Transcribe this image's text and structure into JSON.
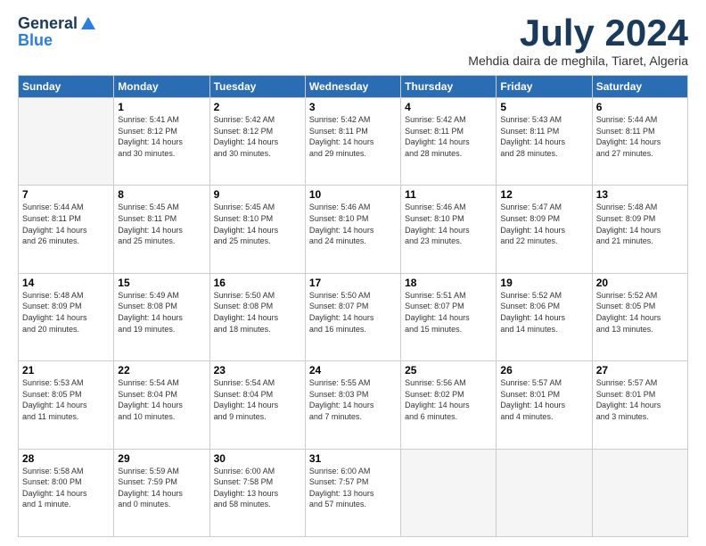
{
  "logo": {
    "general": "General",
    "blue": "Blue"
  },
  "title": "July 2024",
  "location": "Mehdia daira de meghila, Tiaret, Algeria",
  "days_header": [
    "Sunday",
    "Monday",
    "Tuesday",
    "Wednesday",
    "Thursday",
    "Friday",
    "Saturday"
  ],
  "weeks": [
    [
      {
        "day": "",
        "info": ""
      },
      {
        "day": "1",
        "info": "Sunrise: 5:41 AM\nSunset: 8:12 PM\nDaylight: 14 hours\nand 30 minutes."
      },
      {
        "day": "2",
        "info": "Sunrise: 5:42 AM\nSunset: 8:12 PM\nDaylight: 14 hours\nand 30 minutes."
      },
      {
        "day": "3",
        "info": "Sunrise: 5:42 AM\nSunset: 8:11 PM\nDaylight: 14 hours\nand 29 minutes."
      },
      {
        "day": "4",
        "info": "Sunrise: 5:42 AM\nSunset: 8:11 PM\nDaylight: 14 hours\nand 28 minutes."
      },
      {
        "day": "5",
        "info": "Sunrise: 5:43 AM\nSunset: 8:11 PM\nDaylight: 14 hours\nand 28 minutes."
      },
      {
        "day": "6",
        "info": "Sunrise: 5:44 AM\nSunset: 8:11 PM\nDaylight: 14 hours\nand 27 minutes."
      }
    ],
    [
      {
        "day": "7",
        "info": "Sunrise: 5:44 AM\nSunset: 8:11 PM\nDaylight: 14 hours\nand 26 minutes."
      },
      {
        "day": "8",
        "info": "Sunrise: 5:45 AM\nSunset: 8:11 PM\nDaylight: 14 hours\nand 25 minutes."
      },
      {
        "day": "9",
        "info": "Sunrise: 5:45 AM\nSunset: 8:10 PM\nDaylight: 14 hours\nand 25 minutes."
      },
      {
        "day": "10",
        "info": "Sunrise: 5:46 AM\nSunset: 8:10 PM\nDaylight: 14 hours\nand 24 minutes."
      },
      {
        "day": "11",
        "info": "Sunrise: 5:46 AM\nSunset: 8:10 PM\nDaylight: 14 hours\nand 23 minutes."
      },
      {
        "day": "12",
        "info": "Sunrise: 5:47 AM\nSunset: 8:09 PM\nDaylight: 14 hours\nand 22 minutes."
      },
      {
        "day": "13",
        "info": "Sunrise: 5:48 AM\nSunset: 8:09 PM\nDaylight: 14 hours\nand 21 minutes."
      }
    ],
    [
      {
        "day": "14",
        "info": "Sunrise: 5:48 AM\nSunset: 8:09 PM\nDaylight: 14 hours\nand 20 minutes."
      },
      {
        "day": "15",
        "info": "Sunrise: 5:49 AM\nSunset: 8:08 PM\nDaylight: 14 hours\nand 19 minutes."
      },
      {
        "day": "16",
        "info": "Sunrise: 5:50 AM\nSunset: 8:08 PM\nDaylight: 14 hours\nand 18 minutes."
      },
      {
        "day": "17",
        "info": "Sunrise: 5:50 AM\nSunset: 8:07 PM\nDaylight: 14 hours\nand 16 minutes."
      },
      {
        "day": "18",
        "info": "Sunrise: 5:51 AM\nSunset: 8:07 PM\nDaylight: 14 hours\nand 15 minutes."
      },
      {
        "day": "19",
        "info": "Sunrise: 5:52 AM\nSunset: 8:06 PM\nDaylight: 14 hours\nand 14 minutes."
      },
      {
        "day": "20",
        "info": "Sunrise: 5:52 AM\nSunset: 8:05 PM\nDaylight: 14 hours\nand 13 minutes."
      }
    ],
    [
      {
        "day": "21",
        "info": "Sunrise: 5:53 AM\nSunset: 8:05 PM\nDaylight: 14 hours\nand 11 minutes."
      },
      {
        "day": "22",
        "info": "Sunrise: 5:54 AM\nSunset: 8:04 PM\nDaylight: 14 hours\nand 10 minutes."
      },
      {
        "day": "23",
        "info": "Sunrise: 5:54 AM\nSunset: 8:04 PM\nDaylight: 14 hours\nand 9 minutes."
      },
      {
        "day": "24",
        "info": "Sunrise: 5:55 AM\nSunset: 8:03 PM\nDaylight: 14 hours\nand 7 minutes."
      },
      {
        "day": "25",
        "info": "Sunrise: 5:56 AM\nSunset: 8:02 PM\nDaylight: 14 hours\nand 6 minutes."
      },
      {
        "day": "26",
        "info": "Sunrise: 5:57 AM\nSunset: 8:01 PM\nDaylight: 14 hours\nand 4 minutes."
      },
      {
        "day": "27",
        "info": "Sunrise: 5:57 AM\nSunset: 8:01 PM\nDaylight: 14 hours\nand 3 minutes."
      }
    ],
    [
      {
        "day": "28",
        "info": "Sunrise: 5:58 AM\nSunset: 8:00 PM\nDaylight: 14 hours\nand 1 minute."
      },
      {
        "day": "29",
        "info": "Sunrise: 5:59 AM\nSunset: 7:59 PM\nDaylight: 14 hours\nand 0 minutes."
      },
      {
        "day": "30",
        "info": "Sunrise: 6:00 AM\nSunset: 7:58 PM\nDaylight: 13 hours\nand 58 minutes."
      },
      {
        "day": "31",
        "info": "Sunrise: 6:00 AM\nSunset: 7:57 PM\nDaylight: 13 hours\nand 57 minutes."
      },
      {
        "day": "",
        "info": ""
      },
      {
        "day": "",
        "info": ""
      },
      {
        "day": "",
        "info": ""
      }
    ]
  ]
}
